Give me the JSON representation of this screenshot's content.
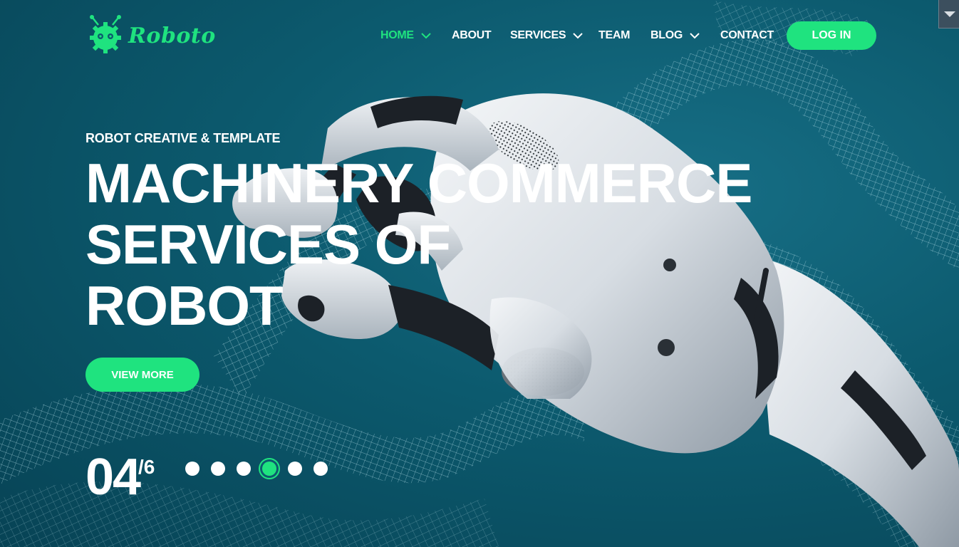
{
  "brand": {
    "name": "Roboto",
    "accent_color": "#1fe37f"
  },
  "nav": {
    "items": [
      {
        "label": "HOME",
        "active": true,
        "has_dropdown": true
      },
      {
        "label": "ABOUT",
        "active": false,
        "has_dropdown": false
      },
      {
        "label": "SERVICES",
        "active": false,
        "has_dropdown": true
      },
      {
        "label": "TEAM",
        "active": false,
        "has_dropdown": false
      },
      {
        "label": "BLOG",
        "active": false,
        "has_dropdown": true
      },
      {
        "label": "CONTACT",
        "active": false,
        "has_dropdown": false
      }
    ],
    "login_label": "LOG IN"
  },
  "hero": {
    "subtitle": "ROBOT CREATIVE & TEMPLATE",
    "title_lines": [
      "MACHINERY COMMERCE",
      "SERVICES OF",
      "ROBOT"
    ],
    "cta_label": "VIEW MORE"
  },
  "slider": {
    "current": "04",
    "total": "/6",
    "dot_count": 6,
    "active_index": 3
  },
  "icons": {
    "logo": "robot-gear-icon",
    "dropdown": "chevron-down-icon",
    "corner": "caret-down-icon"
  }
}
